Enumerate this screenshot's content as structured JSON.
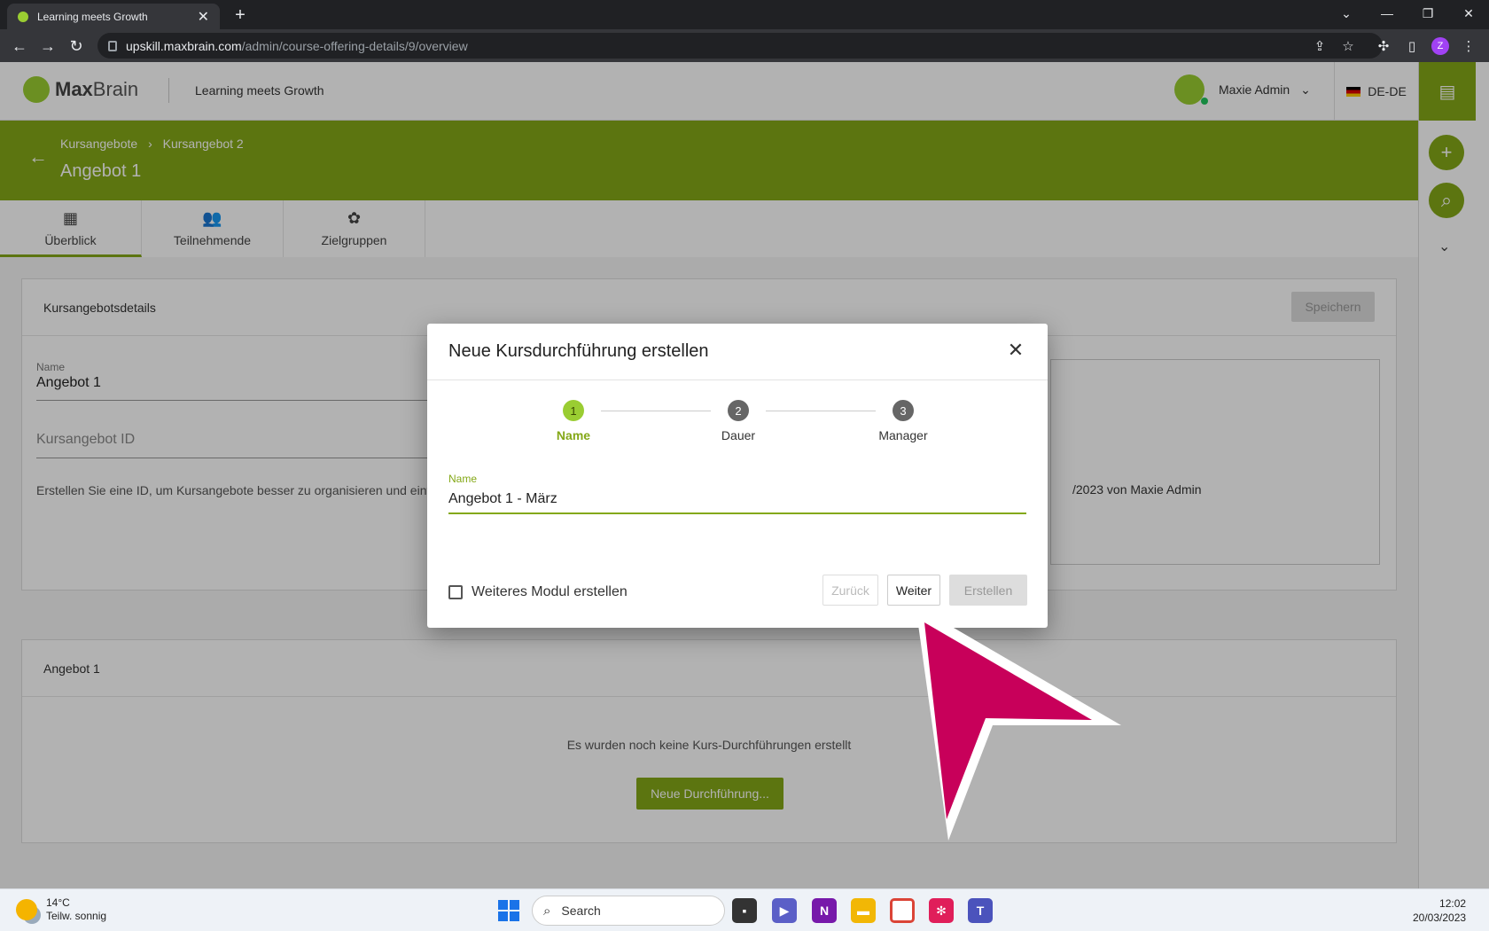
{
  "browser": {
    "tab_title": "Learning meets Growth",
    "url_host": "upskill.maxbrain.com",
    "url_path": "/admin/course-offering-details/9/overview",
    "profile_initial": "Z"
  },
  "header": {
    "logo_max": "Max",
    "logo_brain": "Brain",
    "tagline": "Learning meets Growth",
    "user_name": "Maxie Admin",
    "language": "DE-DE"
  },
  "breadcrumb": [
    "Kursangebote",
    "Kursangebot 2"
  ],
  "page_title": "Angebot 1",
  "tabs": [
    {
      "label": "Überblick",
      "icon": "dashboard-icon"
    },
    {
      "label": "Teilnehmende",
      "icon": "people-icon"
    },
    {
      "label": "Zielgruppen",
      "icon": "groups-icon"
    }
  ],
  "details_card": {
    "title": "Kursangebotsdetails",
    "save_label": "Speichern",
    "name_label": "Name",
    "name_value": "Angebot 1",
    "id_placeholder": "Kursangebot ID",
    "help_text": "Erstellen Sie eine ID, um Kursangebote besser zu organisieren und einfac",
    "created_text": "/2023 von Maxie Admin"
  },
  "offering_card": {
    "title": "Angebot 1",
    "empty_text": "Es wurden noch keine Kurs-Durchführungen erstellt",
    "new_button": "Neue Durchführung..."
  },
  "modal": {
    "title": "Neue Kursdurchführung erstellen",
    "steps": [
      {
        "num": "1",
        "label": "Name"
      },
      {
        "num": "2",
        "label": "Dauer"
      },
      {
        "num": "3",
        "label": "Manager"
      }
    ],
    "field_label": "Name",
    "field_value": "Angebot 1 - März",
    "checkbox_label": "Weiteres Modul erstellen",
    "back_label": "Zurück",
    "next_label": "Weiter",
    "create_label": "Erstellen"
  },
  "taskbar": {
    "temp": "14°C",
    "weather": "Teilw. sonnig",
    "search": "Search",
    "time": "12:02",
    "date": "20/03/2023"
  },
  "colors": {
    "brand_green": "#84a817",
    "step_green": "#9acd32",
    "cursor_pink": "#c8005a"
  }
}
